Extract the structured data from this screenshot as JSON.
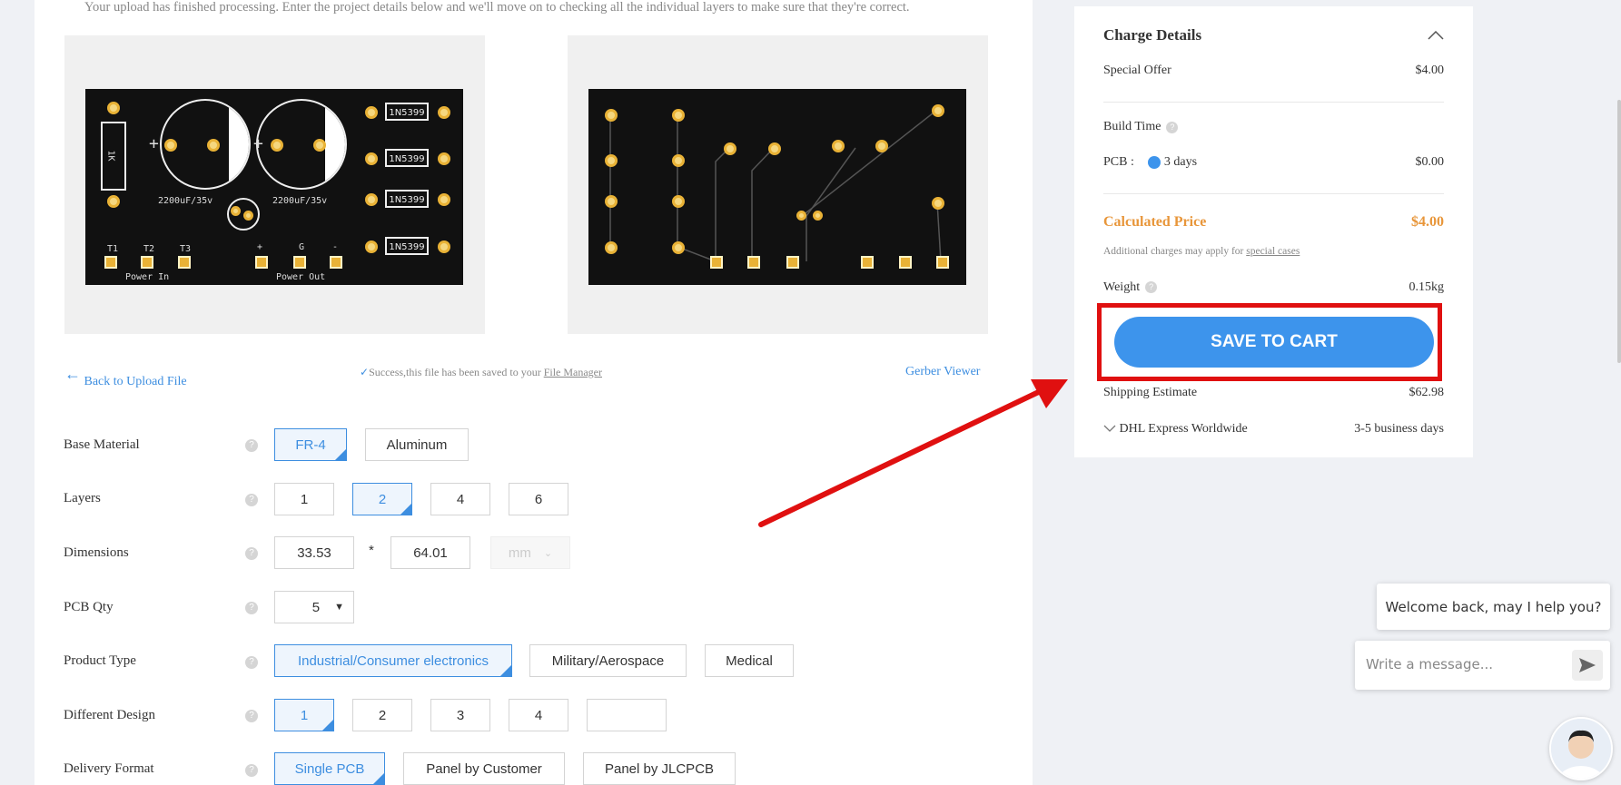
{
  "intro_text": "Your upload has finished processing. Enter the project details below and we'll move on to checking all the individual layers to make sure that they're correct.",
  "pcb_front": {
    "resistor_label": "1K",
    "cap_labels": [
      "2200uF/35v",
      "2200uF/35v"
    ],
    "diode_labels": [
      "1N5399",
      "1N5399",
      "1N5399",
      "1N5399"
    ],
    "terminal_labels": [
      "T1",
      "T2",
      "T3",
      "+",
      "G",
      "-"
    ],
    "power_in": "Power In",
    "power_out": "Power Out"
  },
  "links": {
    "back": "Back to Upload File",
    "success_text": "Success,this file has been saved to your",
    "file_manager": "File Manager",
    "gerber_viewer": "Gerber Viewer"
  },
  "form": {
    "base_material": {
      "label": "Base Material",
      "options": [
        "FR-4",
        "Aluminum"
      ],
      "selected": "FR-4"
    },
    "layers": {
      "label": "Layers",
      "options": [
        "1",
        "2",
        "4",
        "6"
      ],
      "selected": "2"
    },
    "dimensions": {
      "label": "Dimensions",
      "width": "33.53",
      "times": "*",
      "height": "64.01",
      "unit": "mm"
    },
    "pcb_qty": {
      "label": "PCB Qty",
      "value": "5"
    },
    "product_type": {
      "label": "Product Type",
      "options": [
        "Industrial/Consumer electronics",
        "Military/Aerospace",
        "Medical"
      ],
      "selected": "Industrial/Consumer electronics"
    },
    "different_design": {
      "label": "Different Design",
      "options": [
        "1",
        "2",
        "3",
        "4",
        ""
      ],
      "selected": "1"
    },
    "delivery_format": {
      "label": "Delivery Format",
      "options": [
        "Single PCB",
        "Panel by Customer",
        "Panel by JLCPCB"
      ],
      "selected": "Single PCB"
    }
  },
  "charge": {
    "title": "Charge Details",
    "special_offer": {
      "label": "Special Offer",
      "value": "$4.00"
    },
    "build_time": "Build Time",
    "pcb": {
      "label": "PCB :",
      "option": "3 days",
      "value": "$0.00"
    },
    "calculated": {
      "label": "Calculated Price",
      "value": "$4.00"
    },
    "note": "Additional charges may apply for",
    "note_link": "special cases",
    "weight": {
      "label": "Weight",
      "value": "0.15kg"
    },
    "cart_button": "SAVE TO CART",
    "shipping": {
      "label": "Shipping Estimate",
      "value": "$62.98"
    },
    "carrier": {
      "name": "DHL Express Worldwide",
      "time": "3-5 business days"
    }
  },
  "chat": {
    "welcome": "Welcome back, may I help you?",
    "placeholder": "Write a message..."
  },
  "colors": {
    "accent": "#3d94ec",
    "price": "#e8963a",
    "highlight": "#e01010"
  }
}
